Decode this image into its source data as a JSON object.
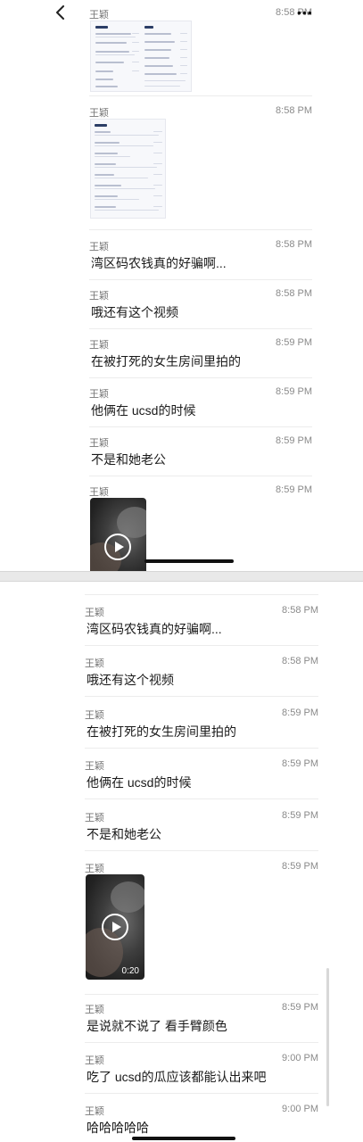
{
  "header": {
    "back_icon": "chevron-left-icon",
    "more_icon": "more-dots-icon",
    "more_label": "•••"
  },
  "top_panel": {
    "messages": [
      {
        "sender": "王颖",
        "time": "8:58 PM",
        "type": "image-document"
      },
      {
        "sender": "王颖",
        "time": "8:58 PM",
        "type": "image-document"
      },
      {
        "sender": "王颖",
        "time": "8:58 PM",
        "text": "湾区码农钱真的好骗啊..."
      },
      {
        "sender": "王颖",
        "time": "8:58 PM",
        "text": "哦还有这个视频"
      },
      {
        "sender": "王颖",
        "time": "8:59 PM",
        "text": "在被打死的女生房间里拍的"
      },
      {
        "sender": "王颖",
        "time": "8:59 PM",
        "text": "他俩在 ucsd的时候"
      },
      {
        "sender": "王颖",
        "time": "8:59 PM",
        "text": "不是和她老公"
      },
      {
        "sender": "王颖",
        "time": "8:59 PM",
        "type": "video"
      }
    ]
  },
  "bottom_panel": {
    "messages": [
      {
        "sender": "王颖",
        "time": "8:58 PM",
        "text": "湾区码农钱真的好骗啊..."
      },
      {
        "sender": "王颖",
        "time": "8:58 PM",
        "text": "哦还有这个视频"
      },
      {
        "sender": "王颖",
        "time": "8:59 PM",
        "text": "在被打死的女生房间里拍的"
      },
      {
        "sender": "王颖",
        "time": "8:59 PM",
        "text": "他俩在 ucsd的时候"
      },
      {
        "sender": "王颖",
        "time": "8:59 PM",
        "text": "不是和她老公"
      },
      {
        "sender": "王颖",
        "time": "8:59 PM",
        "type": "video",
        "duration": "0:20"
      },
      {
        "sender": "王颖",
        "time": "8:59 PM",
        "text": "是说就不说了 看手臂颜色"
      },
      {
        "sender": "王颖",
        "time": "9:00 PM",
        "text": "吃了 ucsd的瓜应该都能认出来吧"
      },
      {
        "sender": "王颖",
        "time": "9:00 PM",
        "text": "哈哈哈哈哈"
      }
    ]
  },
  "colors": {
    "background": "#ffffff",
    "sender_text": "#777777",
    "time_text": "#8a8a8a",
    "message_text": "#1a1a1a",
    "divider": "#ececec"
  }
}
